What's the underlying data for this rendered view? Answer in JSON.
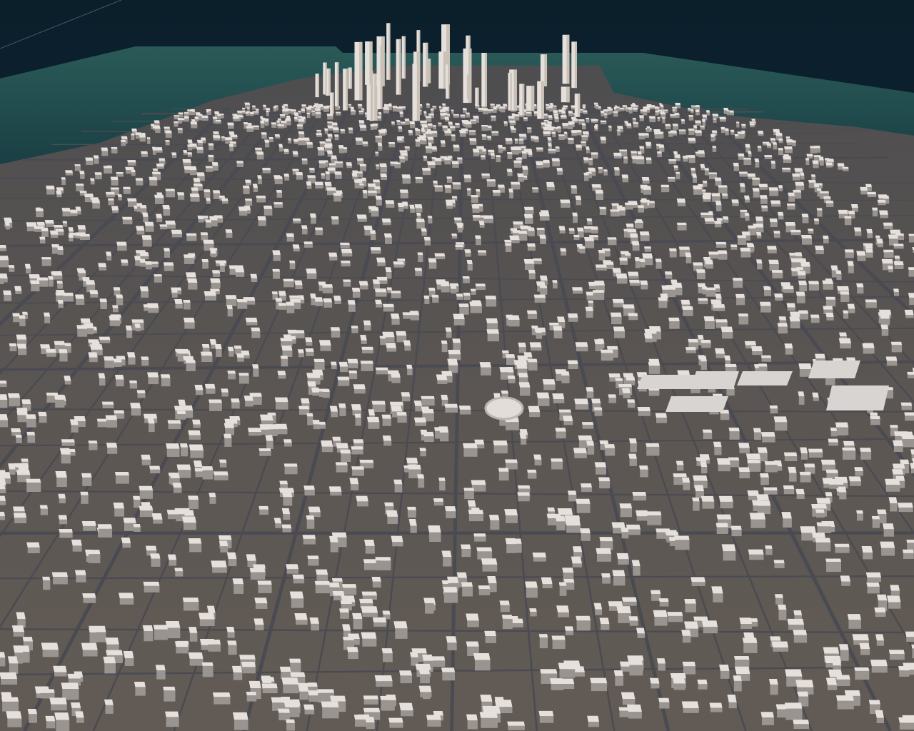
{
  "map": {
    "view": "3d-city-buildings",
    "colors": {
      "sky": "#0c2330",
      "sea": "#1f4a4a",
      "sea_shallow": "#2f6a60",
      "land": "#5a5652",
      "road": "#4a4b52",
      "building": "#e6e0dc",
      "building_shade": "#9a9490"
    }
  }
}
